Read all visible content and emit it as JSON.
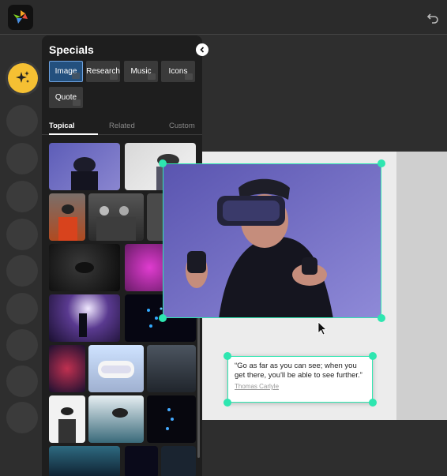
{
  "panel": {
    "title": "Specials",
    "chips": [
      "Image",
      "Research",
      "Music",
      "Icons",
      "Quote"
    ],
    "active_chip": "Image",
    "tabs": [
      "Topical",
      "Related",
      "Custom"
    ],
    "active_tab": "Topical"
  },
  "canvas": {
    "quote_text": "“Go as far as you can see; when you get there, you'll be able to see further.”",
    "quote_author": "Thomas Carlyle"
  },
  "icons": {
    "logo": "app-logo-icon",
    "undo": "undo-icon",
    "magic": "sparkles-icon",
    "collapse": "chevron-left-icon",
    "cursor": "mouse-pointer-icon"
  },
  "colors": {
    "selection": "#2ee6b0",
    "magic_button": "#f5c033",
    "active_chip": "#23507e"
  }
}
